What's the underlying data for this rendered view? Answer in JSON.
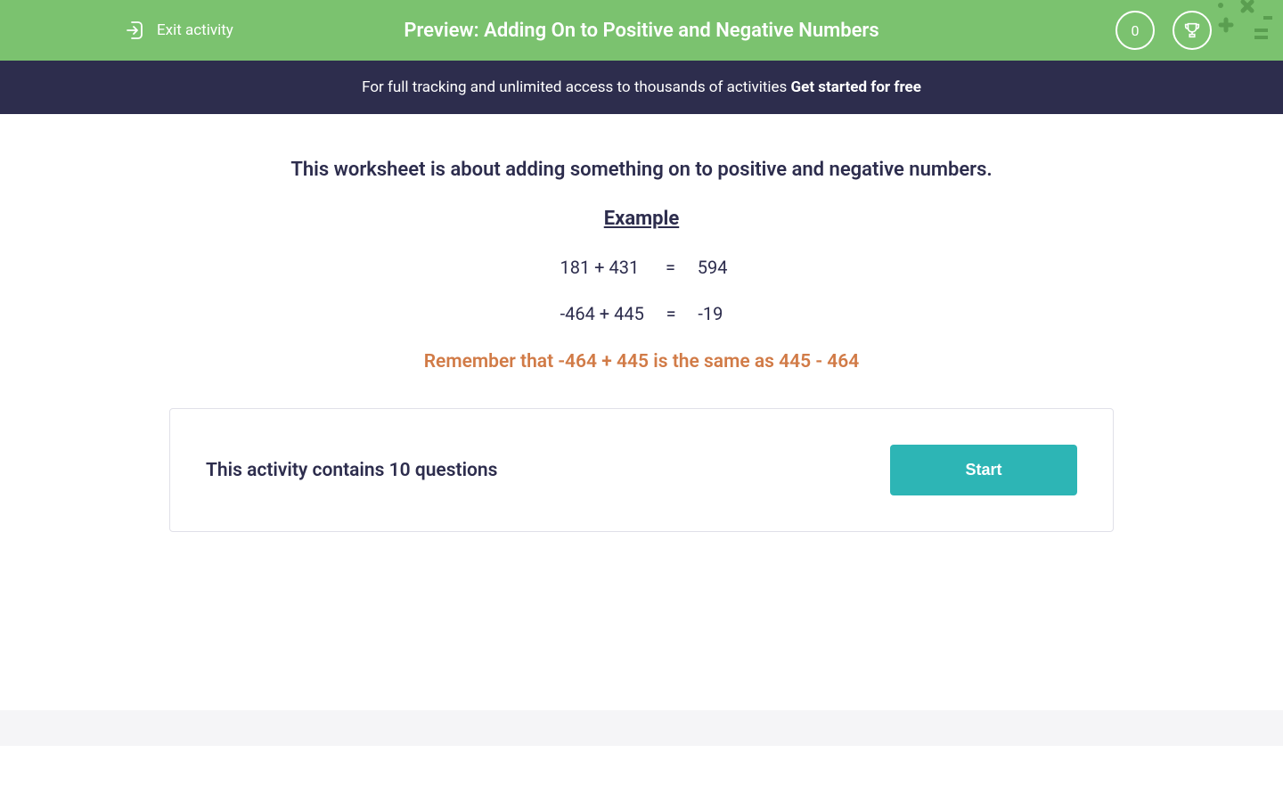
{
  "header": {
    "exit_label": "Exit activity",
    "title": "Preview: Adding On to Positive and Negative Numbers",
    "score": "0"
  },
  "banner": {
    "text": "For full tracking and unlimited access to thousands of activities ",
    "link_text": "Get started for free"
  },
  "content": {
    "intro": "This worksheet is about adding something on to positive and negative numbers.",
    "example_heading": "Example",
    "example_line_1": " 181 + 431      =     594",
    "example_line_2": "-464 + 445     =     -19",
    "remember": "Remember that -464 + 445 is the same as 445 - 464"
  },
  "activity": {
    "question_count": "This activity contains 10 questions",
    "start_label": "Start"
  }
}
